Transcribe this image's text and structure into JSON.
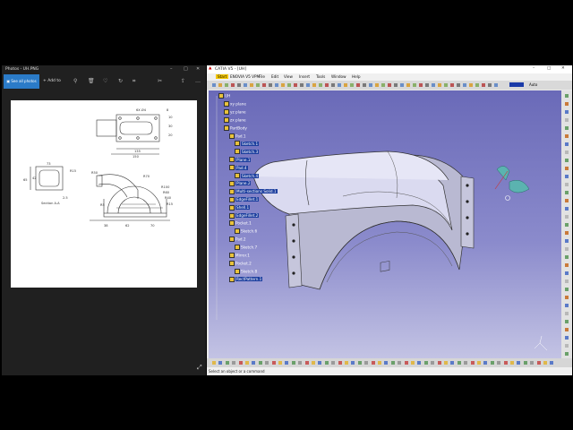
{
  "photos": {
    "title": "Photos - UH.PNG",
    "see_all": "See all photos",
    "add_to": "Add to",
    "drawing": {
      "label_6x": "6X Ø4",
      "label_r15": "R15",
      "label_r50": "R50",
      "label_r70": "R70",
      "label_r100": "R100",
      "label_r60": "R60",
      "label_r40": "R40",
      "label_r15b": "R15",
      "label_r5": "R5",
      "label_section": "Section A-A",
      "label_135": "135",
      "label_150": "150",
      "label_8": "8",
      "label_10": "10",
      "label_30": "30",
      "label_20": "20",
      "label_73": "73",
      "label_65": "65",
      "label_2_5": "2.5",
      "label_38": "38",
      "label_62": "62",
      "label_70": "70",
      "label_42": "42"
    }
  },
  "catia": {
    "title": "CATIA V5 - [UH]",
    "menus": [
      "Start",
      "ENOVIA V5 VPM",
      "File",
      "Edit",
      "View",
      "Insert",
      "Tools",
      "Window",
      "Help"
    ],
    "tree": [
      {
        "label": "UH",
        "sel": false
      },
      {
        "label": "xy plane",
        "sel": false
      },
      {
        "label": "yz plane",
        "sel": false
      },
      {
        "label": "zx plane",
        "sel": false
      },
      {
        "label": "PartBody",
        "sel": false
      },
      {
        "label": "Pad.1",
        "sel": false
      },
      {
        "label": "Sketch.1",
        "sel": true
      },
      {
        "label": "Sketch.3",
        "sel": true
      },
      {
        "label": "Plane.1",
        "sel": true
      },
      {
        "label": "Pad.4",
        "sel": true
      },
      {
        "label": "Sketch.4",
        "sel": true
      },
      {
        "label": "Plane.2",
        "sel": true
      },
      {
        "label": "Multi-sections Solid.1",
        "sel": true
      },
      {
        "label": "EdgeFillet.1",
        "sel": true
      },
      {
        "label": "Shell.1",
        "sel": true
      },
      {
        "label": "EdgeFillet.2",
        "sel": true
      },
      {
        "label": "Pocket.1",
        "sel": false
      },
      {
        "label": "Sketch.6",
        "sel": false
      },
      {
        "label": "Pad.2",
        "sel": false
      },
      {
        "label": "Sketch.7",
        "sel": false
      },
      {
        "label": "Mirror.1",
        "sel": false
      },
      {
        "label": "Pocket.2",
        "sel": false
      },
      {
        "label": "Sketch.8",
        "sel": false
      },
      {
        "label": "RectPattern.1",
        "sel": true
      }
    ],
    "status": "Select an object or a command",
    "auto_label": "Auto",
    "accent": "#1c3e9e"
  }
}
